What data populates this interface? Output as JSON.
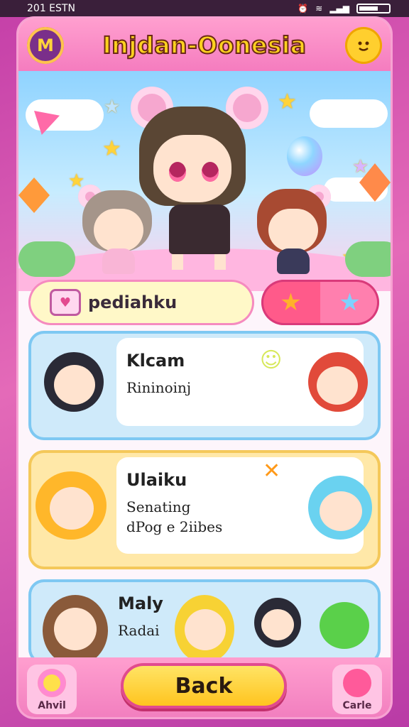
{
  "status": {
    "time": "201 ESTN"
  },
  "header": {
    "title": "Injdan-Oonesia",
    "left_icon": "M",
    "right_icon": "face-icon"
  },
  "search": {
    "text": "pediahku"
  },
  "cards": [
    {
      "name": "Klcam",
      "lines": [
        "Rininoinj"
      ],
      "bg": "#cfeafa",
      "border": "#7ec8f2"
    },
    {
      "name": "Ulaiku",
      "lines": [
        "Senating",
        "dPog e 2iibes"
      ],
      "bg": "#ffe8a8",
      "border": "#f4c85a"
    },
    {
      "name": "Maly",
      "lines": [
        "Radai"
      ],
      "bg": "#cfeafa",
      "border": "#7ec8f2"
    }
  ],
  "bottom": {
    "left_label": "Ahvil",
    "back_label": "Back",
    "right_label": "Carle"
  },
  "colors": {
    "accent_pink": "#f57cbf",
    "accent_yellow": "#ffd21f"
  }
}
